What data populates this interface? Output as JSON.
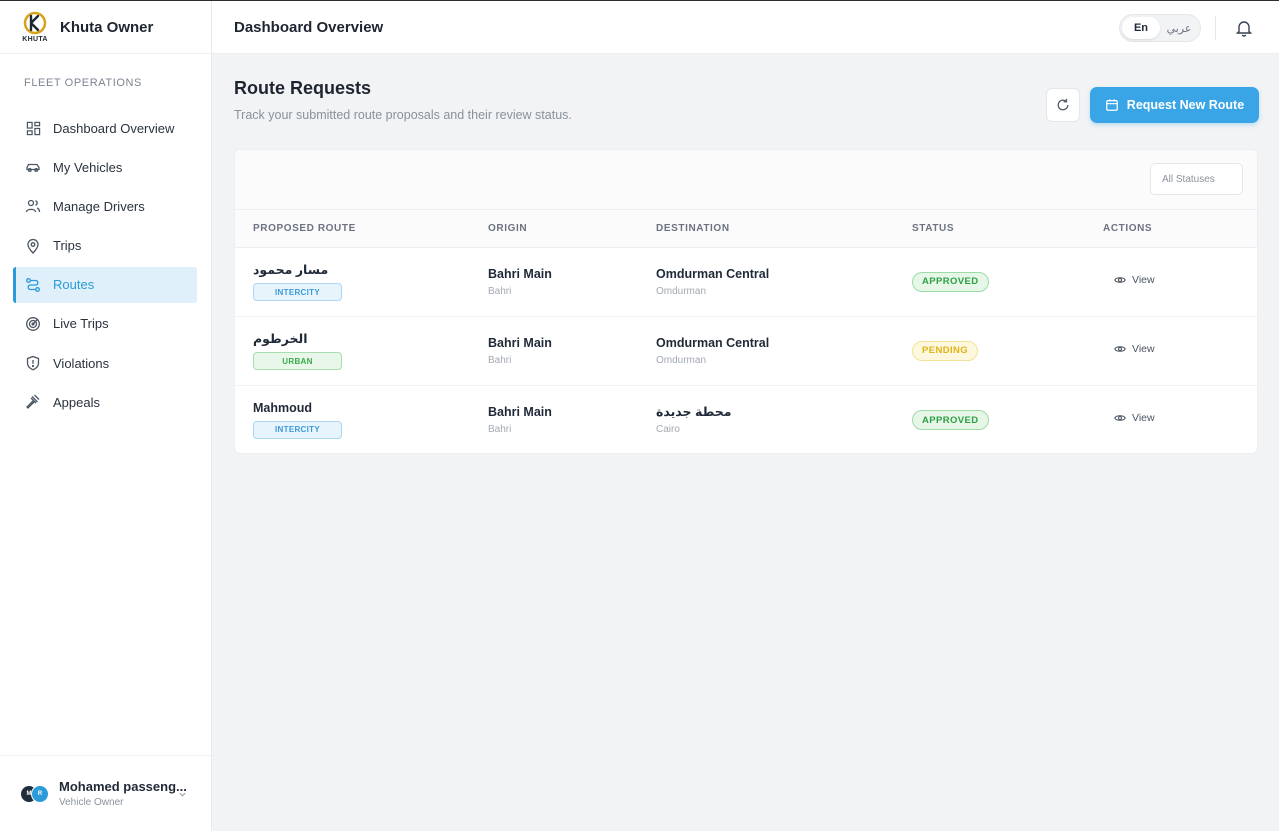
{
  "brand": {
    "title": "Khuta Owner",
    "logo_text": "KHUTA"
  },
  "sidebar": {
    "section_label": "FLEET OPERATIONS",
    "items": [
      {
        "label": "Dashboard Overview",
        "icon": "dashboard-grid-icon"
      },
      {
        "label": "My Vehicles",
        "icon": "car-icon"
      },
      {
        "label": "Manage Drivers",
        "icon": "users-icon"
      },
      {
        "label": "Trips",
        "icon": "map-pin-icon"
      },
      {
        "label": "Routes",
        "icon": "route-icon",
        "active": true
      },
      {
        "label": "Live Trips",
        "icon": "radar-icon"
      },
      {
        "label": "Violations",
        "icon": "shield-alert-icon"
      },
      {
        "label": "Appeals",
        "icon": "gavel-icon"
      }
    ]
  },
  "user": {
    "name": "Mohamed passeng...",
    "role": "Vehicle Owner",
    "avatar_1": "M",
    "avatar_2": "R"
  },
  "header": {
    "title": "Dashboard Overview",
    "lang_en": "En",
    "lang_ar": "عربي"
  },
  "page": {
    "title": "Route Requests",
    "subtitle": "Track your submitted route proposals and their review status.",
    "primary_button": "Request New Route",
    "filter_value": "All Statuses"
  },
  "table": {
    "columns": [
      "PROPOSED ROUTE",
      "ORIGIN",
      "DESTINATION",
      "STATUS",
      "ACTIONS"
    ],
    "rows": [
      {
        "route": "مسار محمود",
        "type": "INTERCITY",
        "origin": "Bahri Main",
        "origin_sub": "Bahri",
        "dest": "Omdurman Central",
        "dest_sub": "Omdurman",
        "status": "APPROVED",
        "action": "View"
      },
      {
        "route": "الخرطوم",
        "type": "URBAN",
        "origin": "Bahri Main",
        "origin_sub": "Bahri",
        "dest": "Omdurman Central",
        "dest_sub": "Omdurman",
        "status": "PENDING",
        "action": "View"
      },
      {
        "route": "Mahmoud",
        "type": "INTERCITY",
        "origin": "Bahri Main",
        "origin_sub": "Bahri",
        "dest": "محطة جديدة",
        "dest_sub": "Cairo",
        "status": "APPROVED",
        "action": "View"
      }
    ]
  },
  "colors": {
    "accent": "#3aa5e6",
    "approved": "#2e9e44",
    "pending": "#e0b51a"
  }
}
